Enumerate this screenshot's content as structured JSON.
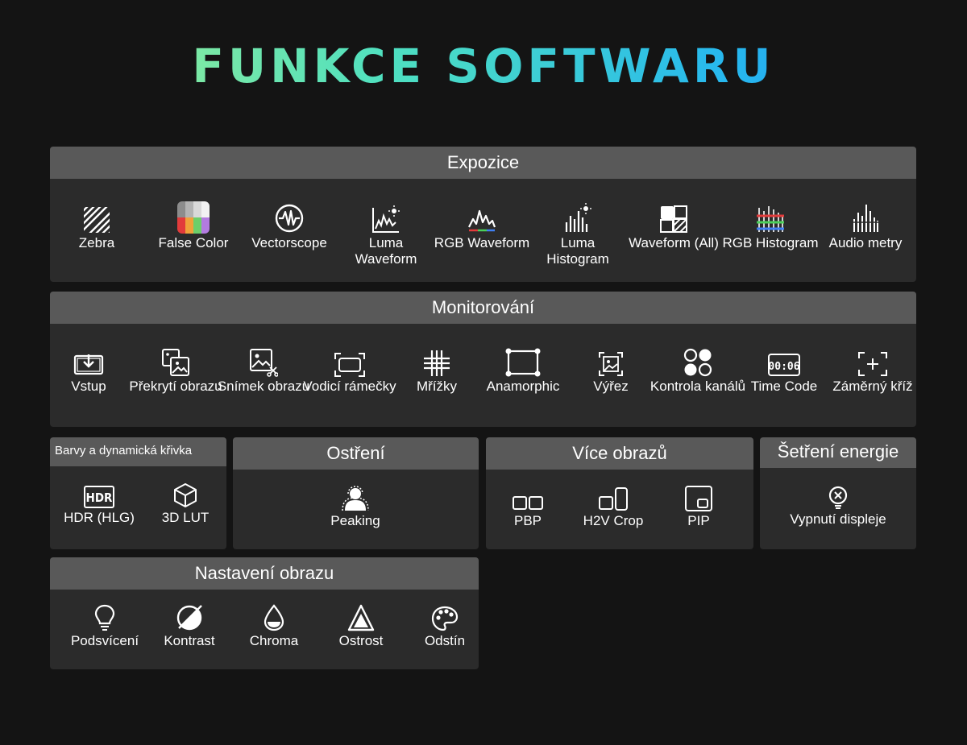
{
  "title": "FUNKCE SOFTWARU",
  "panels": {
    "expozice": {
      "title": "Expozice",
      "items": [
        {
          "label": "Zebra",
          "icon": "zebra-icon"
        },
        {
          "label": "False Color",
          "icon": "false-color-icon"
        },
        {
          "label": "Vectorscope",
          "icon": "vectorscope-icon"
        },
        {
          "label": "Luma Waveform",
          "icon": "luma-waveform-icon"
        },
        {
          "label": "RGB Waveform",
          "icon": "rgb-waveform-icon"
        },
        {
          "label": "Luma Histogram",
          "icon": "luma-histogram-icon"
        },
        {
          "label": "Waveform (All)",
          "icon": "waveform-all-icon"
        },
        {
          "label": "RGB Histogram",
          "icon": "rgb-histogram-icon"
        },
        {
          "label": "Audio metry",
          "icon": "audio-meter-icon"
        }
      ]
    },
    "monitorovani": {
      "title": "Monitorování",
      "items": [
        {
          "label": "Vstup",
          "icon": "input-icon"
        },
        {
          "label": "Překrytí obrazu",
          "icon": "image-overlay-icon"
        },
        {
          "label": "Snímek obrazu",
          "icon": "snapshot-icon"
        },
        {
          "label": "Vodicí rámečky",
          "icon": "frame-guide-icon"
        },
        {
          "label": "Mřížky",
          "icon": "grid-icon"
        },
        {
          "label": "Anamorphic",
          "icon": "anamorphic-icon"
        },
        {
          "label": "Výřez",
          "icon": "crop-icon"
        },
        {
          "label": "Kontrola kanálů",
          "icon": "channel-check-icon"
        },
        {
          "label": "Time Code",
          "icon": "timecode-icon"
        },
        {
          "label": "Záměrný kříž",
          "icon": "crosshair-icon"
        }
      ]
    },
    "barvy": {
      "title": "Barvy a dynamická křivka",
      "items": [
        {
          "label": "HDR (HLG)",
          "icon": "hdr-icon"
        },
        {
          "label": "3D LUT",
          "icon": "lut-cube-icon"
        }
      ]
    },
    "ostreni": {
      "title": "Ostření",
      "items": [
        {
          "label": "Peaking",
          "icon": "peaking-icon"
        }
      ]
    },
    "vice": {
      "title": "Více obrazů",
      "items": [
        {
          "label": "PBP",
          "icon": "pbp-icon"
        },
        {
          "label": "H2V Crop",
          "icon": "h2v-crop-icon"
        },
        {
          "label": "PIP",
          "icon": "pip-icon"
        }
      ]
    },
    "energie": {
      "title": "Šetření energie",
      "items": [
        {
          "label": "Vypnutí displeje",
          "icon": "display-off-icon"
        }
      ]
    },
    "nastaveni": {
      "title": "Nastavení obrazu",
      "items": [
        {
          "label": "Podsvícení",
          "icon": "backlight-icon"
        },
        {
          "label": "Kontrast",
          "icon": "contrast-icon"
        },
        {
          "label": "Chroma",
          "icon": "chroma-icon"
        },
        {
          "label": "Ostrost",
          "icon": "sharpness-icon"
        },
        {
          "label": "Odstín",
          "icon": "hue-palette-icon"
        }
      ]
    }
  }
}
